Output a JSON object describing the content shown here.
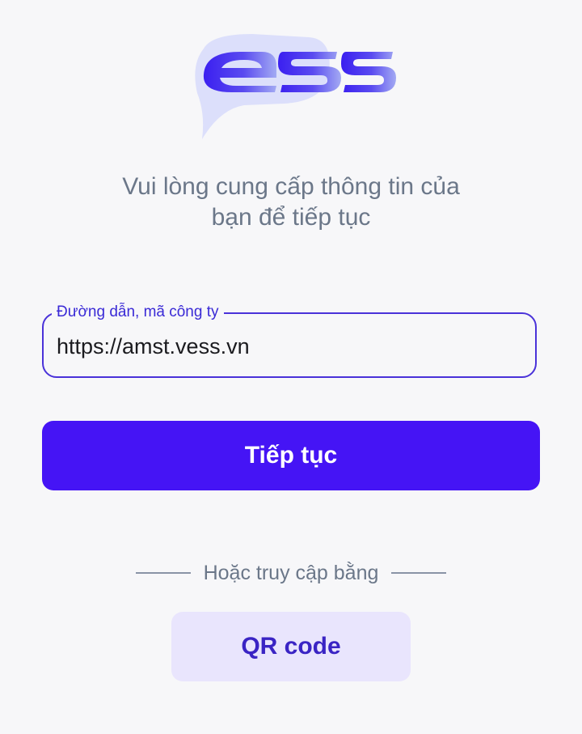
{
  "logo": {
    "text": "ess",
    "colors": {
      "bubble": "#dcdffb",
      "letters_start": "#3b1ff0",
      "letters_end": "#9aa2f2"
    }
  },
  "subtitle": {
    "line1": "Vui lòng cung cấp thông tin của",
    "line2": "bạn để tiếp tục"
  },
  "company_field": {
    "label": "Đường dẫn, mã công ty",
    "value": "https://amst.vess.vn"
  },
  "continue_button": {
    "label": "Tiếp tục"
  },
  "alternative": {
    "divider_text": "Hoặc truy cập bằng",
    "qr_button_label": "QR code"
  },
  "colors": {
    "background": "#f7f7f9",
    "primary": "#4514f5",
    "field_border": "#4a32d9",
    "muted_text": "#6b7789",
    "qr_button_bg": "#e9e5fd",
    "qr_button_text": "#3a24c4"
  }
}
